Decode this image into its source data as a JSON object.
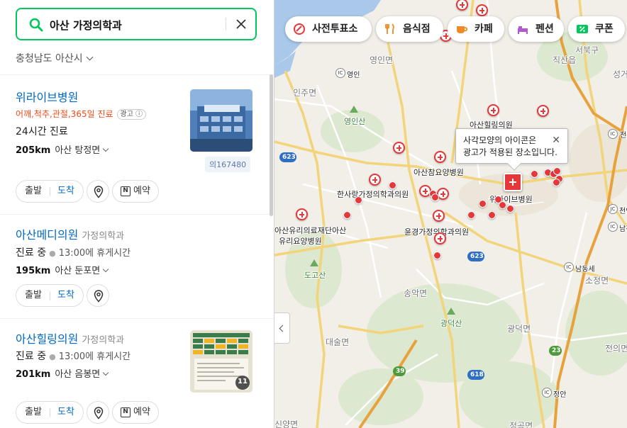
{
  "search": {
    "query": "아산 가정의학과"
  },
  "region": {
    "label": "충청남도 아산시"
  },
  "results": [
    {
      "name": "위라이브병원",
      "category": "",
      "promo": "어깨,척추,관절,365일 진료",
      "ad_badge": "광고",
      "status": "24시간 진료",
      "status_sub": "",
      "distance": "205km",
      "address": "아산 탕정면",
      "reviews": "의167480",
      "thumb_count": "",
      "buttons": {
        "depart": "출발",
        "arrive": "도착",
        "book": "예약"
      }
    },
    {
      "name": "아산메디의원",
      "category": "가정의학과",
      "promo": "",
      "ad_badge": "",
      "status": "진료 중",
      "status_sub": "13:00에 휴게시간",
      "distance": "195km",
      "address": "아산 둔포면",
      "reviews": "",
      "thumb_count": "",
      "buttons": {
        "depart": "출발",
        "arrive": "도착",
        "book": ""
      }
    },
    {
      "name": "아산힐링의원",
      "category": "가정의학과",
      "promo": "",
      "ad_badge": "",
      "status": "진료 중",
      "status_sub": "13:00에 휴게시간",
      "distance": "201km",
      "address": "아산 음봉면",
      "reviews": "",
      "thumb_count": "11",
      "buttons": {
        "depart": "출발",
        "arrive": "도착",
        "book": "예약"
      }
    }
  ],
  "filters": [
    {
      "label": "사전투표소",
      "icon": "ballot-icon",
      "color": "#e5383b"
    },
    {
      "label": "음식점",
      "icon": "utensils-icon",
      "color": "#f08a24"
    },
    {
      "label": "카페",
      "icon": "cup-icon",
      "color": "#f08a24"
    },
    {
      "label": "펜션",
      "icon": "bed-icon",
      "color": "#b05ad0"
    },
    {
      "label": "쿠폰",
      "icon": "coupon-icon",
      "color": "#03c75a"
    }
  ],
  "tooltip": {
    "line1": "사각모양의 아이콘은",
    "line2": "광고가 적용된 장소입니다."
  },
  "map_labels": {
    "yeongin_myeon": "영인면",
    "yeongin_ic": "영인",
    "inju_myeon": "인주면",
    "yeonginsan": "영인산",
    "seobuk_gu": "서북구",
    "jiksan": "직산읍",
    "seongge": "성거",
    "cheonan_ic": "천안",
    "jcheonan": "천안",
    "namcheonan": "남천안",
    "namdongse": "남동세",
    "sojeongmyeon": "소정면",
    "asan_healing": "아산힐링의원",
    "asan_chamyoyang": "아산참요양병원",
    "hansarang": "한사랑가정의학과의원",
    "welive": "위라이브병원",
    "asan_yuri_1": "아산유리의료재단아산",
    "asan_yuri_2": "유리요양병원",
    "yunjeong": "윤경가정의학과의원",
    "dogosan": "도고산",
    "songak": "송악면",
    "gwangdeoksan": "광덕산",
    "gwangdeok_myeon": "광덕면",
    "daesul": "대술면",
    "jeonui": "전의면",
    "jeongan_ic": "정안",
    "sinyang": "신양면",
    "jeonggok": "정곡면",
    "shield_623a": "623",
    "shield_623b": "623",
    "shield_618": "618",
    "shield_39": "39",
    "shield_23": "23",
    "jc_label": "JC",
    "ic_label": "IC"
  }
}
